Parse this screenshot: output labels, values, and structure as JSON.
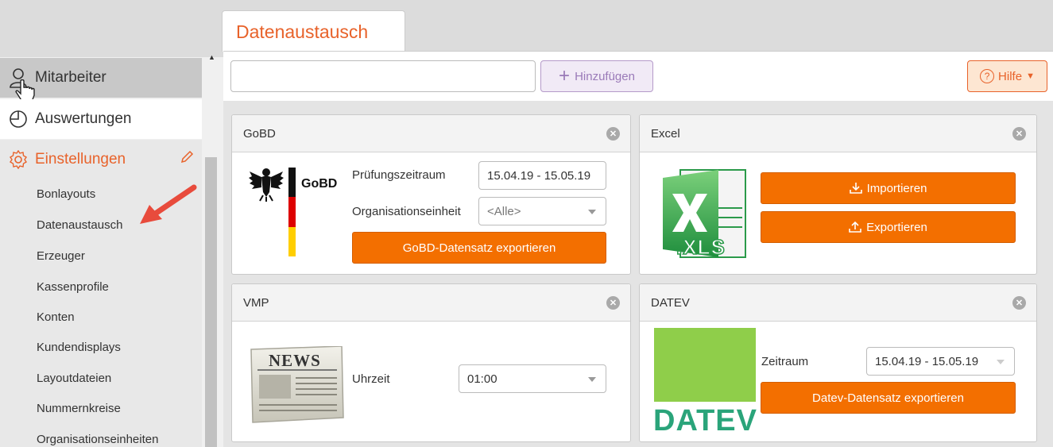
{
  "sidebar": {
    "items": [
      {
        "label": "Mitarbeiter",
        "icon": "user-icon"
      },
      {
        "label": "Auswertungen",
        "icon": "pie-chart-icon"
      },
      {
        "label": "Einstellungen",
        "icon": "gear-icon"
      }
    ],
    "subitems": [
      "Bonlayouts",
      "Datenaustausch",
      "Erzeuger",
      "Kassenprofile",
      "Konten",
      "Kundendisplays",
      "Layoutdateien",
      "Nummernkreise",
      "Organisationseinheiten"
    ]
  },
  "tab": {
    "label": "Datenaustausch"
  },
  "toolbar": {
    "search_value": "",
    "add_label": "Hinzufügen",
    "help_label": "Hilfe"
  },
  "panels": {
    "gobd": {
      "title": "GoBD",
      "logo_text": "GoBD",
      "period_label": "Prüfungszeitraum",
      "period_value": "15.04.19 - 15.05.19",
      "org_label": "Organisationseinheit",
      "org_value": "<Alle>",
      "export_label": "GoBD-Datensatz exportieren"
    },
    "excel": {
      "title": "Excel",
      "logo_text": ".XLS",
      "import_label": "Importieren",
      "export_label": "Exportieren"
    },
    "vmp": {
      "title": "VMP",
      "logo_text": "NEWS",
      "time_label": "Uhrzeit",
      "time_value": "01:00"
    },
    "datev": {
      "title": "DATEV",
      "logo_text": "DATEV",
      "period_label": "Zeitraum",
      "period_value": "15.04.19 - 15.05.19",
      "export_label": "Datev-Datensatz exportieren"
    }
  },
  "colors": {
    "accent": "#e8622a",
    "button": "#f36f00",
    "datev_green": "#8fce4a"
  }
}
